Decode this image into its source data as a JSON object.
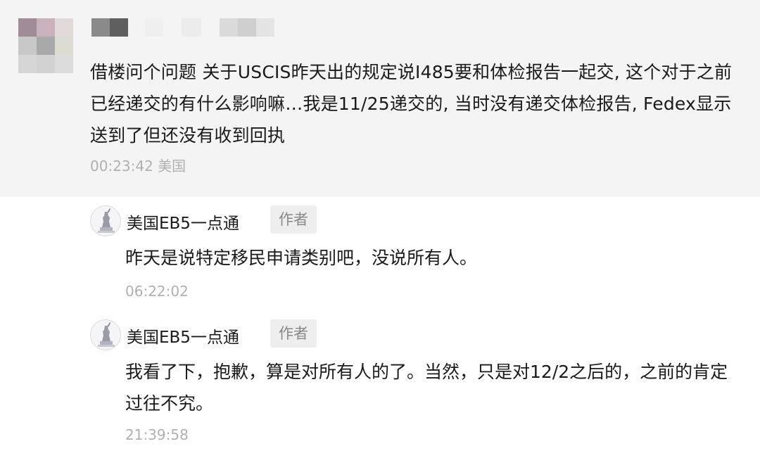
{
  "main_comment": {
    "text": "借楼问个问题 关于USCIS昨天出的规定说I485要和体检报告一起交, 这个对于之前已经递交的有什么影响嘛…我是11/25递交的, 当时没有递交体检报告, Fedex显示送到了但还没有收到回执",
    "time": "00:23:42",
    "location": "美国"
  },
  "replies": [
    {
      "author": "美国EB5一点通",
      "badge": "作者",
      "text": "昨天是说特定移民申请类别吧，没说所有人。",
      "time": "06:22:02"
    },
    {
      "author": "美国EB5一点通",
      "badge": "作者",
      "text": "我看了下，抱歉，算是对所有人的了。当然，只是对12/2之后的，之前的肯定过往不究。",
      "time": "21:39:58"
    }
  ],
  "colors": {
    "comment_background": "#f4f4f4",
    "text": "#1a1a1a",
    "meta_text": "#b0b0b0",
    "badge_background": "#eeeeee",
    "badge_text": "#888888"
  }
}
